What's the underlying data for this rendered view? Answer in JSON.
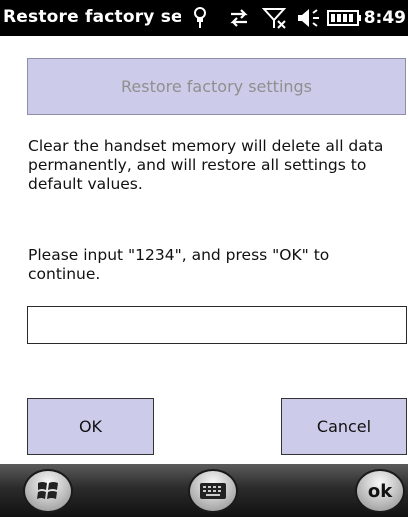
{
  "window": {
    "title": "Restore factory set",
    "time": "8:49"
  },
  "status_icons": [
    "connectivity-icon",
    "sync-arrows-icon",
    "signal-off-icon",
    "volume-icon",
    "battery-icon"
  ],
  "main": {
    "restore_button_label": "Restore factory settings",
    "description": "Clear the handset memory will delete all data permanently, and will restore all settings to default values.",
    "prompt": "Please input \"1234\", and press \"OK\" to continue.",
    "input_value": ""
  },
  "buttons": {
    "ok_label": "OK",
    "cancel_label": "Cancel"
  },
  "taskbar": {
    "ok_label": "ok"
  },
  "colors": {
    "button_fill": "#ccccea",
    "title_bar": "#000000"
  }
}
